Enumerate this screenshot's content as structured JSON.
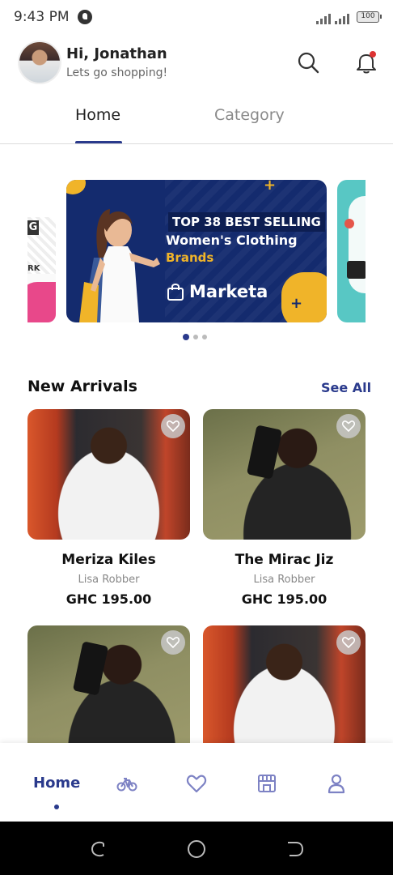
{
  "status_bar": {
    "time": "9:43 PM",
    "battery": "100"
  },
  "header": {
    "greeting": "Hi, Jonathan",
    "subtitle": "Lets go shopping!",
    "icons": [
      "search-icon",
      "bell-icon"
    ]
  },
  "tabs": [
    {
      "label": "Home",
      "active": true
    },
    {
      "label": "Category",
      "active": false
    }
  ],
  "carousel": {
    "active_index": 0,
    "dot_count": 3,
    "main_banner": {
      "headline": "TOP 38 BEST SELLING",
      "line2": "Women's Clothing",
      "line3": "Brands",
      "brand": "Marketa"
    },
    "left_banner": {
      "letter": "G",
      "text": "RK"
    }
  },
  "new_arrivals": {
    "title": "New Arrivals",
    "see_all": "See All",
    "products": [
      {
        "name": "Meriza Kiles",
        "seller": "Lisa Robber",
        "price": "GHC 195.00",
        "image": "market"
      },
      {
        "name": "The Mirac Jiz",
        "seller": "Lisa Robber",
        "price": "GHC 195.00",
        "image": "olive"
      },
      {
        "image": "olive"
      },
      {
        "image": "market"
      }
    ]
  },
  "bottom_nav": {
    "items": [
      {
        "label": "Home",
        "icon": "home",
        "active": true
      },
      {
        "icon": "bicycle-icon"
      },
      {
        "icon": "heart-icon"
      },
      {
        "icon": "store-icon"
      },
      {
        "icon": "user-icon"
      }
    ]
  },
  "colors": {
    "accent": "#2a3a8c",
    "banner_bg": "#142b6e",
    "banner_accent": "#f0b429"
  }
}
